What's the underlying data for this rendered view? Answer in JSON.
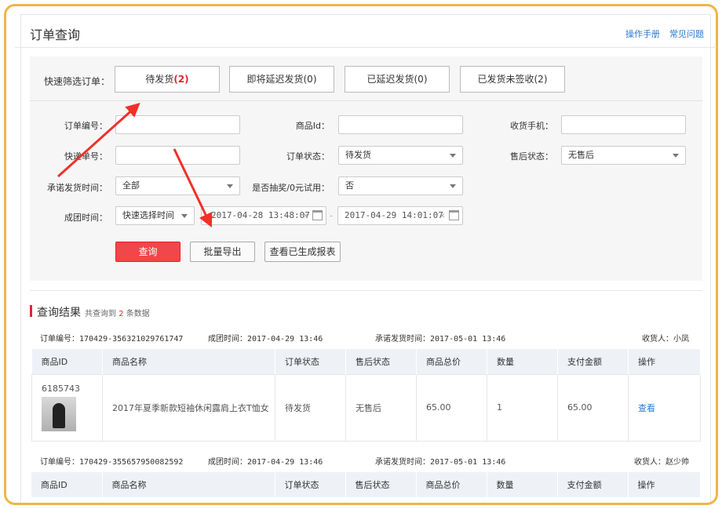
{
  "header": {
    "title": "订单查询",
    "links": [
      "操作手册",
      "常见问题"
    ]
  },
  "quick_filter": {
    "label": "快速筛选订单：",
    "buttons": [
      {
        "label": "待发货",
        "count": "(2)"
      },
      {
        "label": "即将延迟发货(0)"
      },
      {
        "label": "已延迟发货(0)"
      },
      {
        "label": "已发货未签收(2)"
      }
    ]
  },
  "form": {
    "order_no": {
      "label": "订单编号：",
      "value": ""
    },
    "goods_id": {
      "label": "商品Id：",
      "value": ""
    },
    "phone": {
      "label": "收货手机：",
      "value": ""
    },
    "express_no": {
      "label": "快递单号：",
      "value": ""
    },
    "order_status": {
      "label": "订单状态：",
      "value": "待发货"
    },
    "after_sale": {
      "label": "售后状态：",
      "value": "无售后"
    },
    "promise_time": {
      "label": "承诺发货时间：",
      "value": "全部"
    },
    "lottery": {
      "label": "是否抽奖/0元试用：",
      "value": "否"
    },
    "group_time": {
      "label": "成团时间：",
      "value": "快速选择时间",
      "start": "2017-04-28 13:48:07",
      "end": "2017-04-29 14:01:07",
      "sep": "-"
    }
  },
  "actions": {
    "query": "查询",
    "export": "批量导出",
    "reports": "查看已生成报表"
  },
  "results": {
    "title": "查询结果",
    "summary_prefix": "共查询到",
    "count": "2",
    "summary_suffix": "条数据",
    "columns": [
      "商品ID",
      "商品名称",
      "订单状态",
      "售后状态",
      "商品总价",
      "数量",
      "支付金额",
      "操作"
    ],
    "orders": [
      {
        "order_no": "订单编号：170429-356321029761747",
        "group_time": "成团时间：2017-04-29 13:46",
        "promise_time": "承诺发货时间：2017-05-01 13:46",
        "receiver": "收货人：小凤",
        "row": {
          "goods_id": "6185743",
          "name": "2017年夏季新款短袖休闲露肩上衣T恤女",
          "status": "待发货",
          "after_sale": "无售后",
          "total": "65.00",
          "qty": "1",
          "paid": "65.00",
          "action": "查看"
        }
      },
      {
        "order_no": "订单编号：170429-355657950082592",
        "group_time": "成团时间：2017-04-29 13:46",
        "promise_time": "承诺发货时间：2017-05-01 13:46",
        "receiver": "收货人：赵少帅"
      }
    ]
  },
  "colors": {
    "frame": "#f0b545",
    "accent": "#e0262a",
    "link": "#2a7ad0"
  }
}
